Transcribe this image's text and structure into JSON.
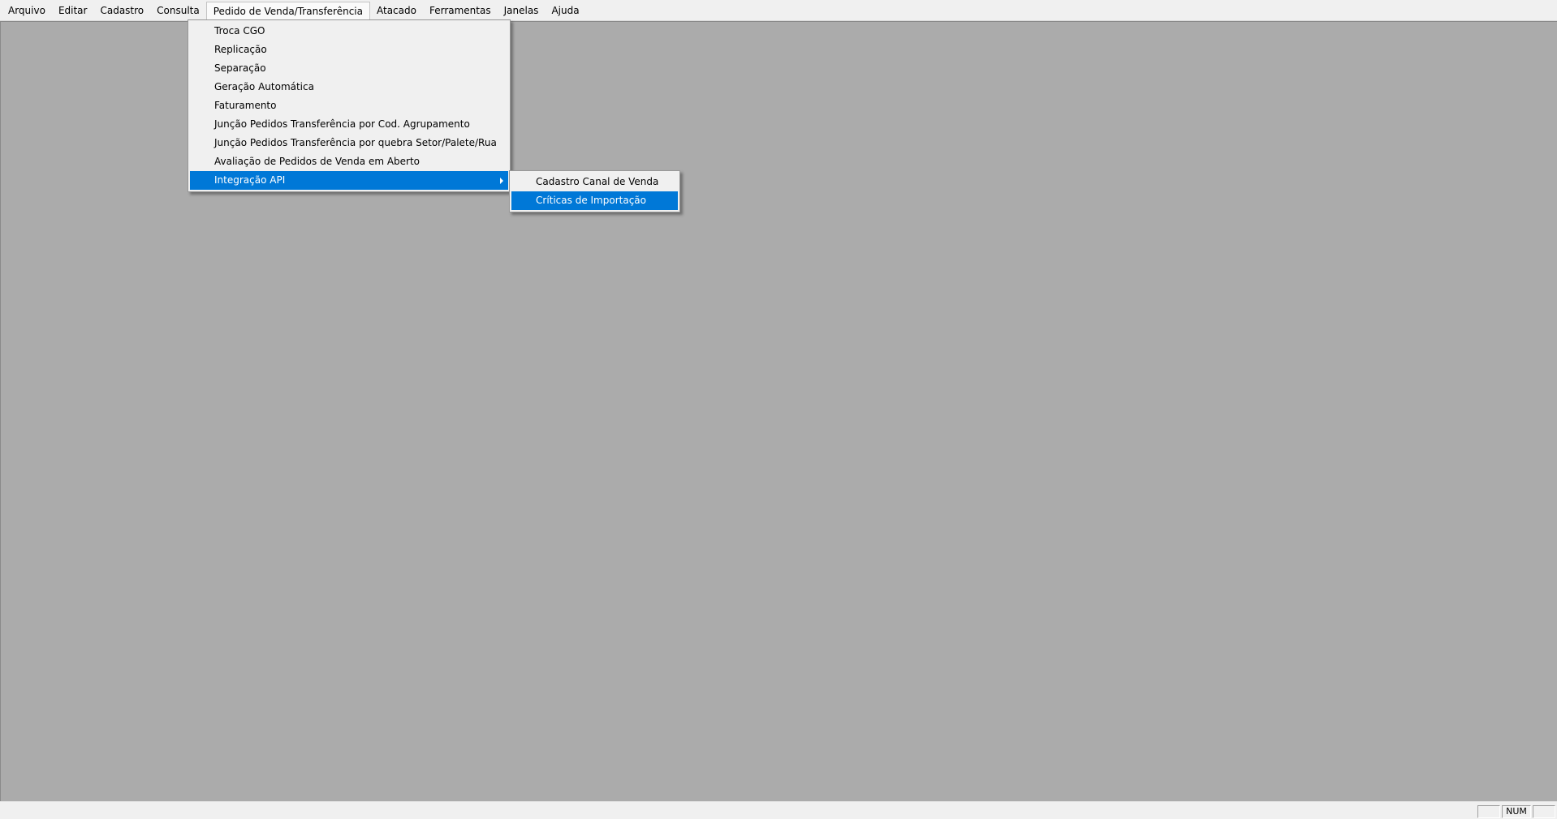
{
  "menubar": {
    "items": [
      {
        "label": "Arquivo"
      },
      {
        "label": "Editar"
      },
      {
        "label": "Cadastro"
      },
      {
        "label": "Consulta"
      },
      {
        "label": "Pedido de Venda/Transferência"
      },
      {
        "label": "Atacado"
      },
      {
        "label": "Ferramentas"
      },
      {
        "label": "Janelas"
      },
      {
        "label": "Ajuda"
      }
    ],
    "active_index": 4
  },
  "pedido_menu": {
    "items": [
      {
        "label": "Troca CGO"
      },
      {
        "label": "Replicação"
      },
      {
        "label": "Separação"
      },
      {
        "label": "Geração Automática"
      },
      {
        "label": "Faturamento"
      },
      {
        "label": "Junção Pedidos Transferência por Cod. Agrupamento"
      },
      {
        "label": "Junção Pedidos Transferência por quebra Setor/Palete/Rua"
      },
      {
        "label": "Avaliação de Pedidos de Venda em Aberto"
      },
      {
        "label": "Integração API"
      }
    ],
    "highlighted_index": 8
  },
  "integracao_submenu": {
    "items": [
      {
        "label": "Cadastro Canal de Venda"
      },
      {
        "label": "Críticas de Importação"
      }
    ],
    "highlighted_index": 1
  },
  "statusbar": {
    "num_indicator": "NUM"
  },
  "colors": {
    "highlight": "#0078d7",
    "workspace": "#ababab",
    "chrome": "#f0f0f0"
  }
}
